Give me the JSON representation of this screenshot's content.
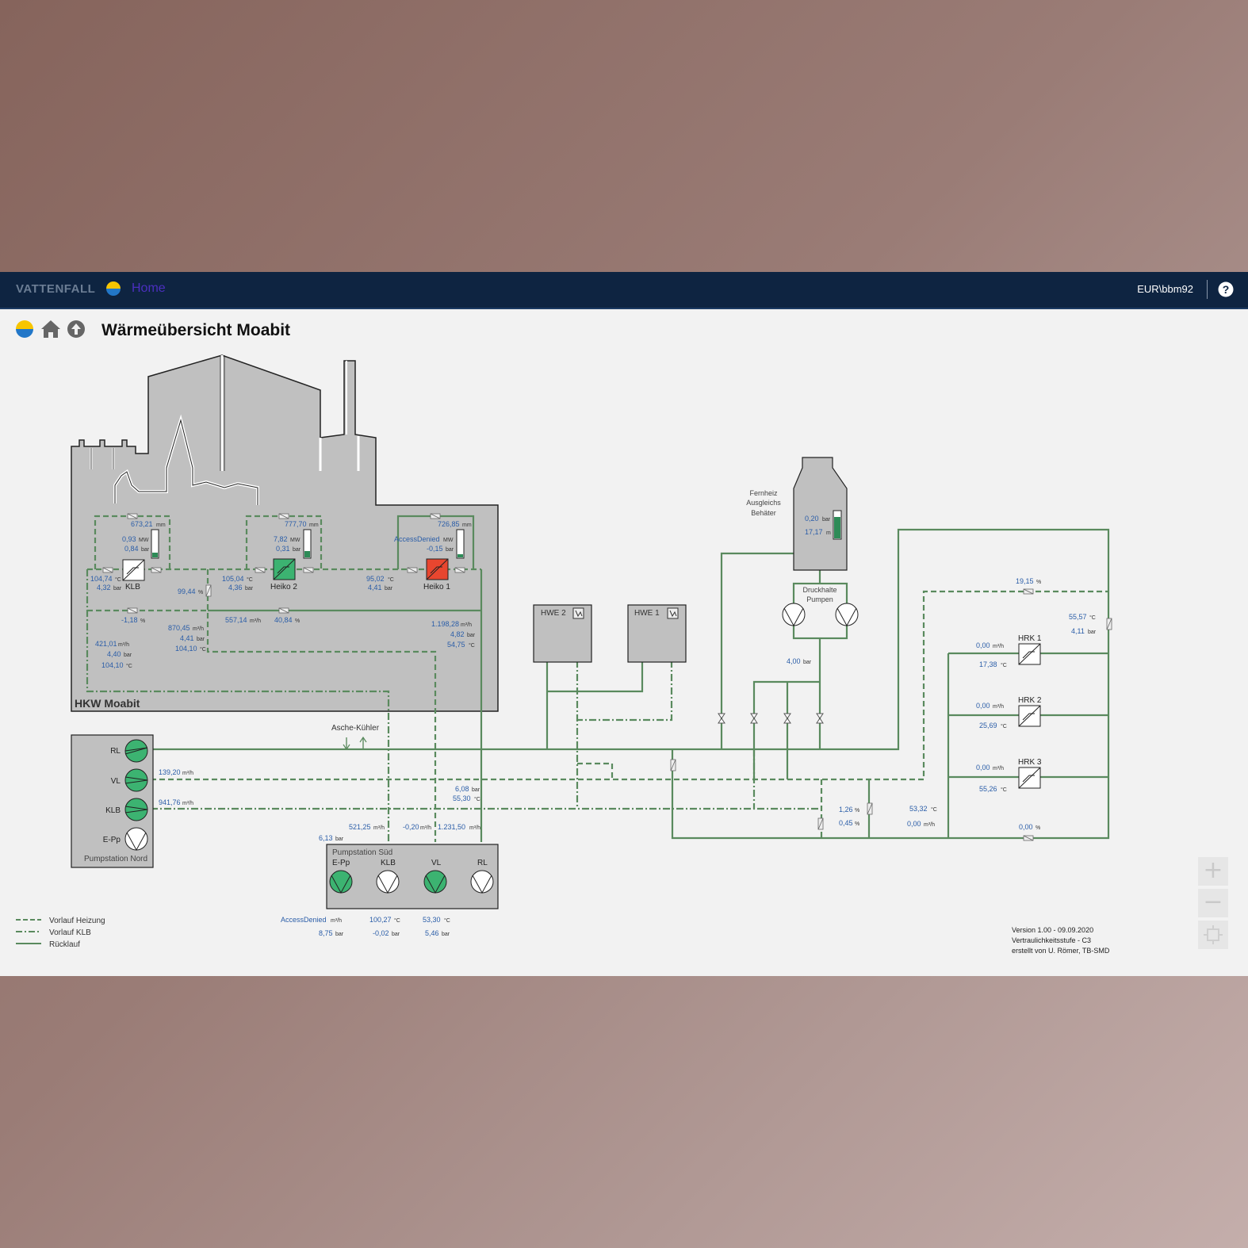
{
  "topbar": {
    "brand": "VATTENFALL",
    "home_link": "Home",
    "user": "EUR\\bbm92",
    "help_label": "?"
  },
  "page_title": "Wärmeübersicht Moabit",
  "colors": {
    "pipe": "#5a8a5e",
    "value_blue": "#2a5da8",
    "building_gray": "#c0c0c0",
    "active_green": "#3cb371",
    "alarm_red": "#e8462f"
  },
  "plant": {
    "name": "HKW Moabit",
    "units": [
      {
        "label": "KLB",
        "level": "673,21",
        "level_unit": "mm",
        "power": "0,93",
        "power_unit": "MW",
        "pressure": "0,84",
        "pressure_unit": "bar",
        "temp": "104,74",
        "temp_unit": "°C",
        "out_pressure": "4,32",
        "out_pressure_unit": "bar",
        "state": "off"
      },
      {
        "label": "Heiko 2",
        "level": "777,70",
        "level_unit": "mm",
        "power": "7,82",
        "power_unit": "MW",
        "pressure": "0,31",
        "pressure_unit": "bar",
        "temp": "105,04",
        "temp_unit": "°C",
        "out_pressure": "4,36",
        "out_pressure_unit": "bar",
        "state": "running"
      },
      {
        "label": "Heiko 1",
        "level": "726,85",
        "level_unit": "mm",
        "power": "AccessDenied",
        "power_unit": "MW",
        "pressure": "-0,15",
        "pressure_unit": "bar",
        "temp": "95,02",
        "temp_unit": "°C",
        "out_pressure": "4,41",
        "out_pressure_unit": "bar",
        "state": "alarm"
      }
    ],
    "valve_pct": "99,44",
    "valve_pct_unit": "%",
    "m1": "-1,18",
    "m1_unit": "%",
    "m2": "557,14",
    "m2_unit": "m³/h",
    "m3": "40,84",
    "m3_unit": "%",
    "flow_a": "870,45",
    "flow_a_unit": "m³/h",
    "press_a": "4,41",
    "press_a_unit": "bar",
    "temp_a": "104,10",
    "temp_a_unit": "°C",
    "flow_b": "421,01",
    "flow_b_unit": "m³/h",
    "press_b": "4,40",
    "press_b_unit": "bar",
    "temp_b": "104,10",
    "temp_b_unit": "°C",
    "flow_c": "1.198,28",
    "flow_c_unit": "m³/h",
    "press_c": "4,82",
    "press_c_unit": "bar",
    "temp_c": "54,75",
    "temp_c_unit": "°C"
  },
  "pumpstation_nord": {
    "title": "Pumpstation Nord",
    "pumps": [
      "RL",
      "VL",
      "KLB",
      "E-Pp"
    ],
    "vl_flow": "139,20",
    "vl_flow_unit": "m³/h",
    "klb_flow": "941,76",
    "klb_flow_unit": "m³/h"
  },
  "asche": "Asche-Kühler",
  "pumpstation_sued": {
    "title": "Pumpstation Süd",
    "pumps": [
      "E-Pp",
      "KLB",
      "VL",
      "RL"
    ],
    "p1": "6,13",
    "p1_unit": "bar",
    "f1": "521,25",
    "f1_unit": "m³/h",
    "f2": "-0,20",
    "f2_unit": "m³/h",
    "f3": "1.231,50",
    "f3_unit": "m³/h",
    "p2": "6,08",
    "p2_unit": "bar",
    "t2": "55,30",
    "t2_unit": "°C",
    "b1": "AccessDenied",
    "b1_unit": "m³/h",
    "b2": "8,75",
    "b2_unit": "bar",
    "b3": "100,27",
    "b3_unit": "°C",
    "b4": "-0,02",
    "b4_unit": "bar",
    "b5": "53,30",
    "b5_unit": "°C",
    "b6": "5,46",
    "b6_unit": "bar"
  },
  "hwe": [
    "HWE 2",
    "HWE 1"
  ],
  "tank": {
    "line1": "Fernheiz",
    "line2": "Ausgleichs",
    "line3": "Behäter",
    "pressure": "0,20",
    "pressure_unit": "bar",
    "level": "17,17",
    "level_unit": "m"
  },
  "druckhalte": {
    "line1": "Druckhalte",
    "line2": "Pumpen",
    "pressure": "4,00",
    "pressure_unit": "bar"
  },
  "right": {
    "v1": "19,15",
    "v1_unit": "%",
    "t1": "55,57",
    "t1_unit": "°C",
    "p1": "4,11",
    "p1_unit": "bar",
    "hrk": [
      {
        "label": "HRK 1",
        "flow": "0,00",
        "flow_unit": "m³/h",
        "temp": "17,38",
        "temp_unit": "°C"
      },
      {
        "label": "HRK 2",
        "flow": "0,00",
        "flow_unit": "m³/h",
        "temp": "25,69",
        "temp_unit": "°C"
      },
      {
        "label": "HRK 3",
        "flow": "0,00",
        "flow_unit": "m³/h",
        "temp": "55,26",
        "temp_unit": "°C"
      }
    ],
    "r1": "1,26",
    "r1_unit": "%",
    "r2": "0,45",
    "r2_unit": "%",
    "r3": "53,32",
    "r3_unit": "°C",
    "r4": "0,00",
    "r4_unit": "m³/h",
    "r5": "0,00",
    "r5_unit": "%"
  },
  "legend": [
    "Vorlauf Heizung",
    "Vorlauf KLB",
    "Rücklauf"
  ],
  "footer": [
    "Version 1.00 - 09.09.2020",
    "Vertraulichkeitsstufe - C3",
    "erstellt von U. Römer, TB-SMD"
  ],
  "zoom": {
    "in": "+",
    "out": "−"
  }
}
